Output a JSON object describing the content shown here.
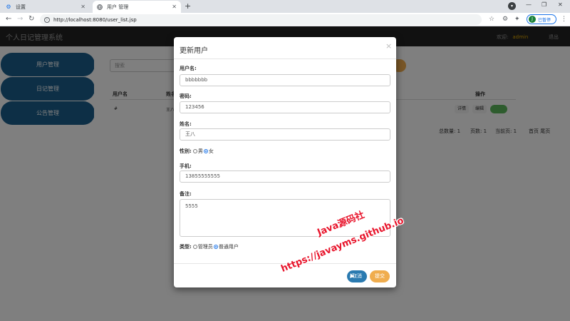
{
  "browser": {
    "tabs": [
      {
        "label": "设置",
        "icon": "gear-icon"
      },
      {
        "label": "用户 管理",
        "icon": "globe-icon"
      }
    ],
    "url": "http://localhost:8080/user_list.jsp",
    "profile_label": "已暂停",
    "profile_initial": "J",
    "accent": "#1a73e8"
  },
  "app": {
    "title": "个人日记管理系统",
    "welcome_label": "欢迎:",
    "username": "admin",
    "logout_label": "退出",
    "header_color": "#222222"
  },
  "sidebar": {
    "items": [
      {
        "label": "用户管理"
      },
      {
        "label": "日记管理"
      },
      {
        "label": "公告管理"
      }
    ],
    "color": "#1b5e8c"
  },
  "list": {
    "search_placeholder": "搜索",
    "columns": [
      "用户名",
      "姓名",
      "操作"
    ],
    "row": {
      "username": "#",
      "name": "王八",
      "actions": [
        "详情",
        "编辑"
      ]
    },
    "pager": {
      "total_label": "总数量:",
      "total": "1",
      "pages_label": "页数:",
      "pages": "1",
      "current_label": "当前页:",
      "current": "1",
      "nav": "首页 尾页"
    }
  },
  "modal": {
    "title": "更新用户",
    "close": "×",
    "fields": {
      "username": {
        "label": "用户名:",
        "value": "bbbbbbb"
      },
      "password": {
        "label": "密码:",
        "value": "123456"
      },
      "name": {
        "label": "姓名:",
        "value": "王八"
      },
      "gender": {
        "label": "性别:",
        "options": [
          "男",
          "女"
        ],
        "selected": "女"
      },
      "phone": {
        "label": "手机:",
        "value": "13855555555"
      },
      "remark": {
        "label": "备注:",
        "value": "5555"
      },
      "type": {
        "label": "类型:",
        "options": [
          "管理员",
          "普通用户"
        ],
        "selected": "普通用户"
      }
    },
    "cancel_label": "取消",
    "submit_label": "提交"
  },
  "watermark": {
    "line1": "Java源码社",
    "line2": "https://javayms.github.io",
    "color": "#e8152c"
  }
}
